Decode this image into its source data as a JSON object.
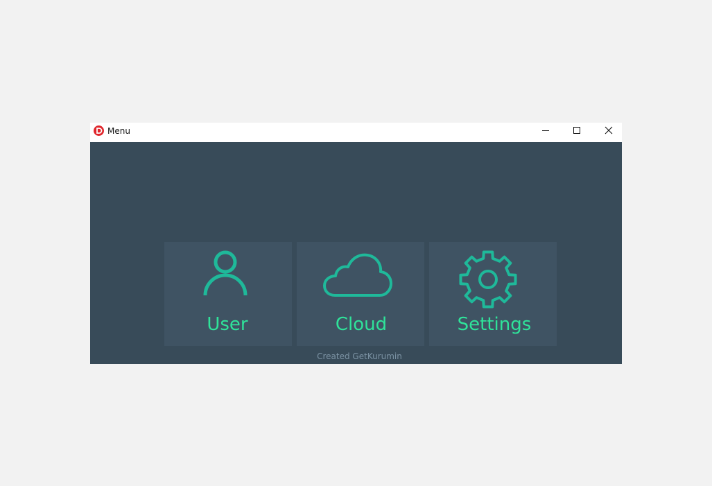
{
  "window": {
    "title": "Menu",
    "app_icon": "red-d-logo-icon",
    "controls": [
      "minimize-icon",
      "maximize-icon",
      "close-icon"
    ]
  },
  "tiles": [
    {
      "label": "User",
      "icon": "user-icon"
    },
    {
      "label": "Cloud",
      "icon": "cloud-icon"
    },
    {
      "label": "Settings",
      "icon": "gear-icon"
    }
  ],
  "footer": {
    "text": "Created GetKurumin"
  },
  "colors": {
    "background": "#f2f2f2",
    "window_body": "#384b59",
    "tile": "#3f5363",
    "icon": "#1fb99a",
    "label": "#2fe39a",
    "footer_text": "#7c93a4"
  }
}
